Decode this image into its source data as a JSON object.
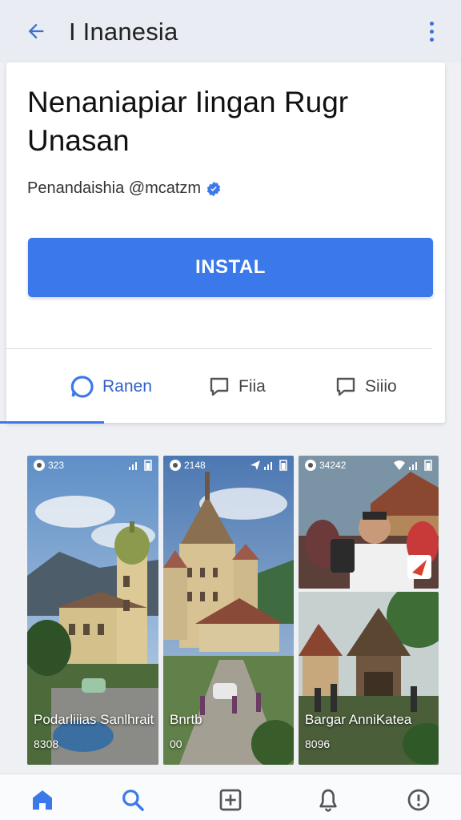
{
  "header": {
    "title": "I Inanesia",
    "back_icon": "arrow-left-icon",
    "menu_icon": "more-vert-icon"
  },
  "app": {
    "name": "Nenaniapiar Iingan Rugr Unasan",
    "developer": "Penandaishia @mcatzm",
    "verified_icon": "verified-badge-icon",
    "install_label": "INSTAL"
  },
  "tabs": [
    {
      "label": "Ranen",
      "icon": "circle-icon",
      "active": true
    },
    {
      "label": "Fiia",
      "icon": "chat-bubble-icon",
      "active": false
    },
    {
      "label": "Siiio",
      "icon": "chat-bubble-icon",
      "active": false
    }
  ],
  "screenshots": [
    {
      "time": "323",
      "caption": "Podarliiias Sanlhrait",
      "subcaption": "8308"
    },
    {
      "time": "2148",
      "caption": "Bnrtb",
      "subcaption": "00"
    },
    {
      "time": "34242",
      "caption": "",
      "subcaption": ""
    },
    {
      "time": "",
      "caption": "Bargar AnniKatea",
      "subcaption": "8096"
    }
  ],
  "bottom_nav": [
    {
      "icon": "home-icon",
      "active": true
    },
    {
      "icon": "search-icon",
      "active": false
    },
    {
      "icon": "add-box-icon",
      "active": false
    },
    {
      "icon": "notifications-icon",
      "active": false
    },
    {
      "icon": "more-circle-icon",
      "active": false
    }
  ],
  "colors": {
    "accent": "#3b78ea",
    "accent_text": "#2f63c9",
    "header_bg": "#e9ecf2"
  }
}
